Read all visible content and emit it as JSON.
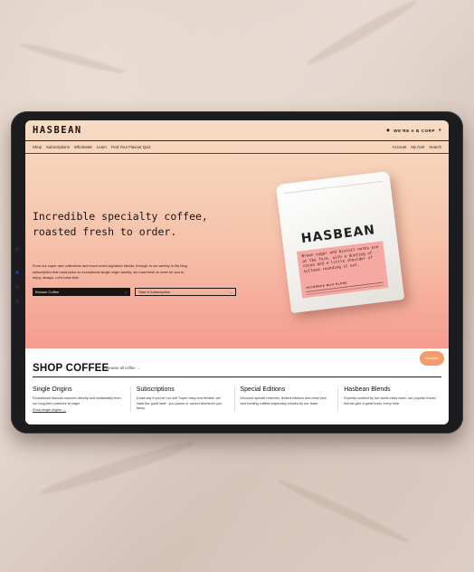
{
  "site": {
    "logo": "HASBEAN",
    "bcorp": "WE'RE A B CORP"
  },
  "nav": {
    "left": [
      "Shop",
      "Subscriptions",
      "Wholesale",
      "Learn",
      "Find Your Flavour Quiz"
    ],
    "right": [
      "Account",
      "My Cart",
      "Search"
    ]
  },
  "hero": {
    "title": "Incredible specialty coffee, roasted fresh to order.",
    "description": "From our super rare collections and much-loved signature blends, through to our weekly In My Mug subscription that hand-picks an exceptional single origin weekly, we roast fresh to order for you to enjoy, always. Let's brew this!",
    "primary_button": "Browse Coffee",
    "secondary_button": "Start A Subscription"
  },
  "product": {
    "brand": "HASBEAN",
    "notes": "Brown sugar and biscuit notes are at the fore, with a dusting of cocoa and a little shoulder of sultana rounding it out.",
    "blend": "JAILBREAK MILK BLEND"
  },
  "shop": {
    "title": "SHOP COFFEE",
    "browse_link": "Browse all coffee →",
    "accounts_label": "Rewards",
    "columns": [
      {
        "title": "Single Origins",
        "text": "Exceptional flavours sourced directly and sustainably from our long-term partners at origin.",
        "link": "Shop single origins →"
      },
      {
        "title": "Subscriptions",
        "text": "A sad day if you've run out! Super easy and flexible, we roast the good stuff - you pause or cancel whenever you fancy.",
        "link": ""
      },
      {
        "title": "Special Editions",
        "text": "Discover special reserves, limited editions and other rare and exciting coffees especially chosen by our team.",
        "link": ""
      },
      {
        "title": "Hasbean Blends",
        "text": "Expertly curated by our world-class team, our popular house blends give a great brew, every time.",
        "link": ""
      }
    ]
  },
  "colors": {
    "hero_top": "#f7dcc4",
    "hero_bottom": "#f3837c",
    "label_pink": "#f6a9a3",
    "accent_orange": "#f49c6b"
  }
}
